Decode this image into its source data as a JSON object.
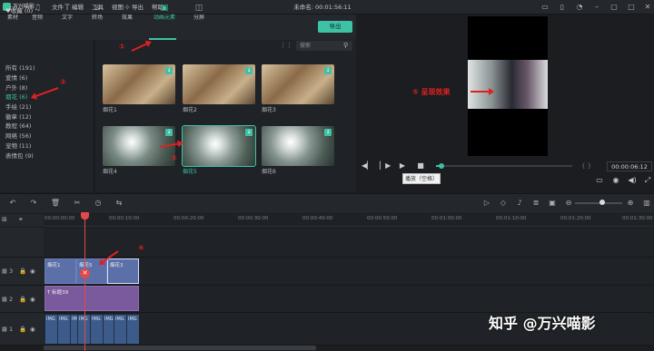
{
  "app": {
    "name": "万兴喵影",
    "project_title": "未命名: 00:01:56:11"
  },
  "menu": [
    "文件",
    "编辑",
    "工具",
    "视图",
    "导出",
    "帮助"
  ],
  "tabs": [
    {
      "label": "素材",
      "icon": "folder-icon"
    },
    {
      "label": "音频",
      "icon": "music-icon"
    },
    {
      "label": "文字",
      "icon": "text-icon"
    },
    {
      "label": "转场",
      "icon": "transition-icon"
    },
    {
      "label": "效果",
      "icon": "effect-icon"
    },
    {
      "label": "动画元素",
      "icon": "element-icon"
    },
    {
      "label": "分屏",
      "icon": "split-icon"
    }
  ],
  "export_label": "导出",
  "sidebar": {
    "favorites": "♥收藏 (0)",
    "categories": [
      "所有 (191)",
      "爱情 (6)",
      "户外 (8)",
      "烟花 (6)",
      "手绘 (21)",
      "徽章 (12)",
      "教程 (64)",
      "网络 (56)",
      "宠物 (11)",
      "表情包 (9)"
    ],
    "active_index": 3
  },
  "search": {
    "placeholder": "搜索"
  },
  "thumbnails": [
    {
      "label": "烟花1"
    },
    {
      "label": "烟花2"
    },
    {
      "label": "烟花3"
    },
    {
      "label": "烟花4"
    },
    {
      "label": "烟花5"
    },
    {
      "label": "烟花6"
    }
  ],
  "player": {
    "tooltip": "播放（空格）",
    "timecode": "00:00:06:12",
    "progress": 0.04,
    "brackets": "{ }"
  },
  "ruler_ticks": [
    "00:00:00:00",
    "00:00:10:00",
    "00:00:20:00",
    "00:00:30:00",
    "00:00:40:00",
    "00:00:50:00",
    "00:01:00:00",
    "00:01:10:00",
    "00:01:20:00",
    "00:01:30:00"
  ],
  "tracks": [
    {
      "name": "3",
      "clips": [
        "烟花1",
        "烟花5",
        "烟花3"
      ]
    },
    {
      "name": "2",
      "clips": [
        "标题39"
      ]
    },
    {
      "name": "1",
      "clips": [
        "IMG",
        "IMG",
        "IMG",
        "IMG",
        "IMG",
        "IMG",
        "IMG",
        "IMG"
      ]
    }
  ],
  "annotations": {
    "a1": "①",
    "a2": "②",
    "a3": "③",
    "a4": "④",
    "a5": "⑤ 呈现效果"
  },
  "watermark": "知乎 @万兴喵影",
  "colors": {
    "accent": "#3fc1a5",
    "annotation": "#e02020",
    "playhead": "#e24a4a"
  }
}
